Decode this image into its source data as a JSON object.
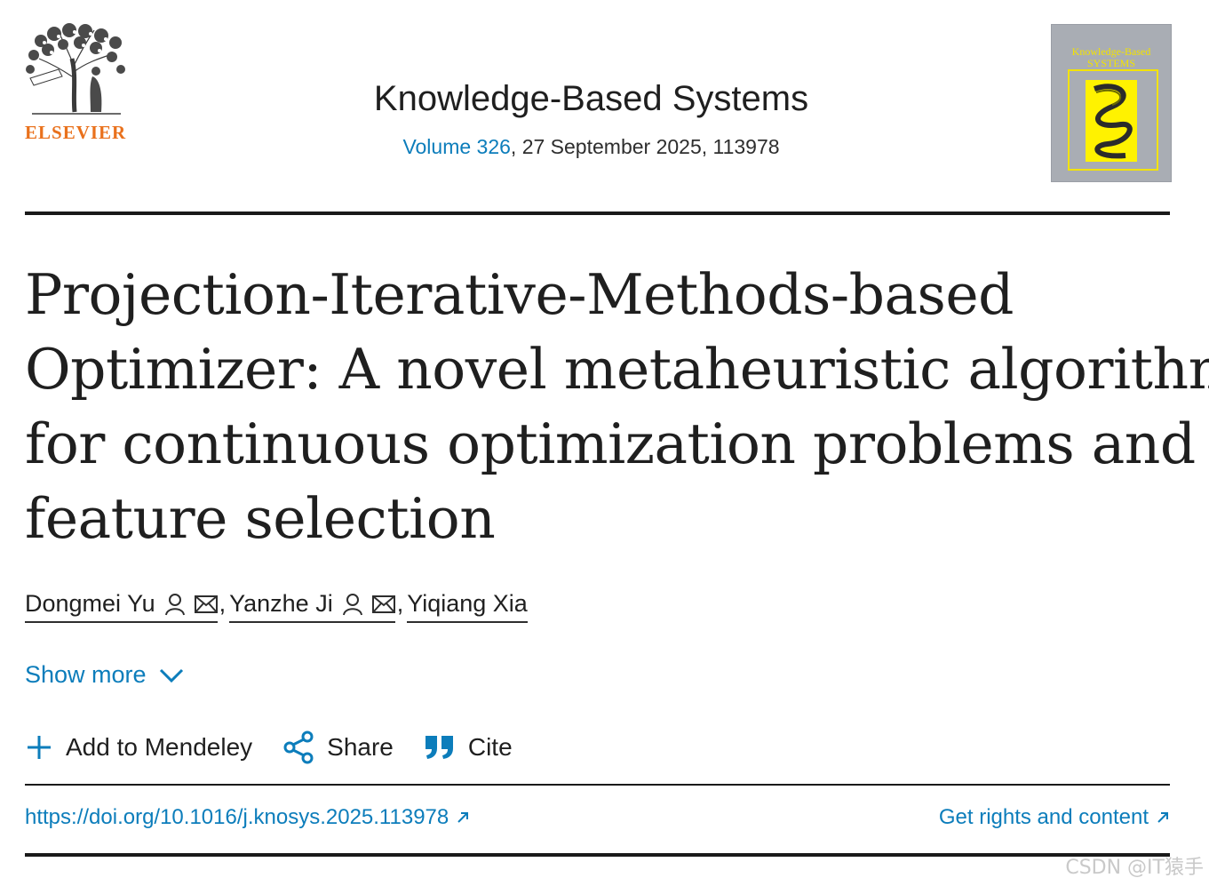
{
  "header": {
    "publisher_logo_text": "ELSEVIER",
    "journal_title": "Knowledge-Based Systems",
    "volume_link": "Volume 326",
    "issue_rest": ", 27 September 2025, 113978",
    "cover_title": "Knowledge-Based SYSTEMS"
  },
  "article": {
    "title_lines": [
      "Projection-Iterative-Methods-based",
      "Optimizer: A novel metaheuristic algorithm",
      "for continuous optimization problems and",
      "feature selection"
    ]
  },
  "authors": [
    {
      "name": "Dongmei Yu",
      "icons": [
        "person-icon",
        "envelope-icon"
      ]
    },
    {
      "name": "Yanzhe Ji",
      "icons": [
        "person-icon",
        "envelope-icon"
      ]
    },
    {
      "name": "Yiqiang Xia",
      "icons": []
    }
  ],
  "author_separator": ",",
  "show_more": {
    "label": "Show more",
    "icon": "chevron-down-icon"
  },
  "actions": [
    {
      "label": "Add to Mendeley",
      "icon": "plus-icon"
    },
    {
      "label": "Share",
      "icon": "share-icon"
    },
    {
      "label": "Cite",
      "icon": "quote-icon"
    }
  ],
  "links": {
    "doi": "https://doi.org/10.1016/j.knosys.2025.113978",
    "rights": "Get rights and content"
  },
  "watermark": "CSDN @IT猿手",
  "colors": {
    "link": "#0c7dbb",
    "brand_orange": "#e9711c",
    "text": "#1f1f1f",
    "cover_yellow": "#fff200"
  }
}
